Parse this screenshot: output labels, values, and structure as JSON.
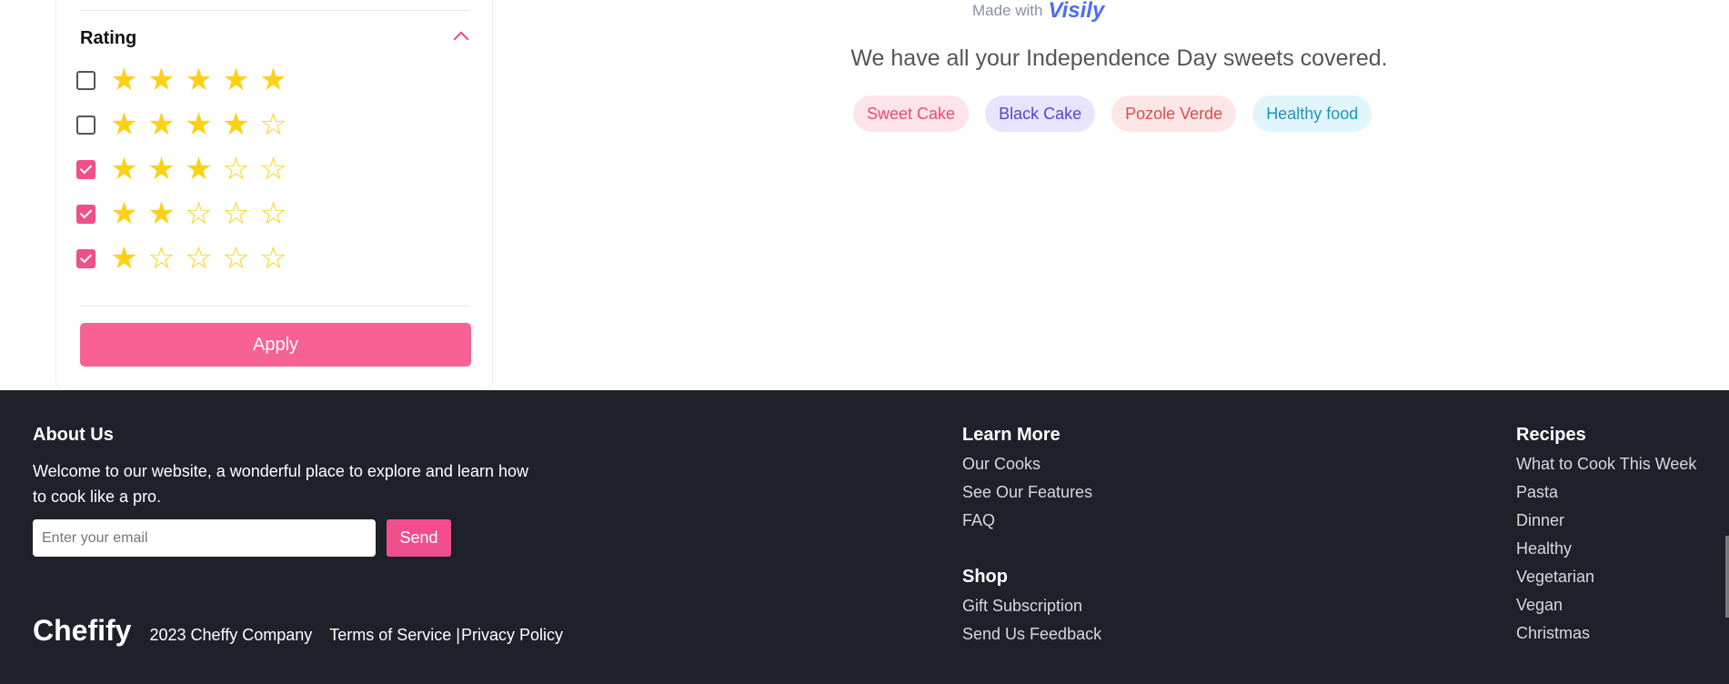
{
  "filter": {
    "rating_title": "Rating",
    "apply_label": "Apply",
    "rows": [
      {
        "stars_filled": 5,
        "checked": false
      },
      {
        "stars_filled": 4,
        "checked": false
      },
      {
        "stars_filled": 3,
        "checked": true
      },
      {
        "stars_filled": 2,
        "checked": true
      },
      {
        "stars_filled": 1,
        "checked": true
      }
    ]
  },
  "hero": {
    "made_with": "Made with",
    "brand_logo": "Visily",
    "tagline": "We have all your Independence Day sweets covered.",
    "tags": [
      "Sweet Cake",
      "Black Cake",
      "Pozole Verde",
      "Healthy food"
    ]
  },
  "footer": {
    "about_title": "About Us",
    "about_text": "Welcome to our website, a wonderful place to explore and learn how to cook like a pro.",
    "email_placeholder": "Enter your email",
    "send_label": "Send",
    "brand": "Chefify",
    "copyright": "2023 Cheffy Company",
    "terms": "Terms of Service",
    "separator": "|",
    "privacy": "Privacy Policy",
    "learn_title": "Learn More",
    "learn_links": [
      "Our Cooks",
      "See Our Features",
      "FAQ"
    ],
    "shop_title": "Shop",
    "shop_links": [
      "Gift Subscription",
      "Send Us Feedback"
    ],
    "recipes_title": "Recipes",
    "recipes_links": [
      "What to Cook This Week",
      "Pasta",
      "Dinner",
      "Healthy",
      "Vegetarian",
      "Vegan",
      "Christmas"
    ]
  },
  "colors": {
    "accent": "#f76194",
    "star": "#fcd116",
    "footer_bg": "#1e2129"
  }
}
